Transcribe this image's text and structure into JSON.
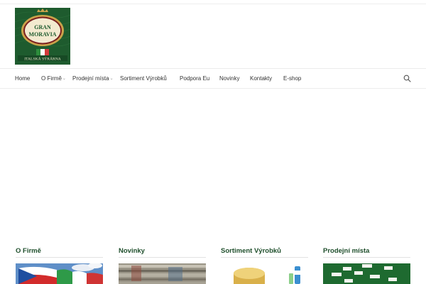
{
  "logo": {
    "brand_line1": "GRAN",
    "brand_line2": "MORAVIA",
    "tagline": "ITALSKÁ SÝRÁRNA",
    "icon": "gran-moravia-logo-icon"
  },
  "nav": {
    "items": [
      {
        "label": "Home"
      },
      {
        "label": "O Firmě",
        "has_submenu": true
      },
      {
        "label": "Prodejní místa",
        "has_submenu": true
      },
      {
        "label": "Sortiment Výrobků"
      },
      {
        "label": "Podpora Eu"
      },
      {
        "label": "Novinky"
      },
      {
        "label": "Kontakty"
      },
      {
        "label": "E-shop"
      }
    ],
    "submenu_icon": "chevron-down-icon",
    "search_icon": "search-icon"
  },
  "columns": [
    {
      "title": "O Firmě",
      "image": "flags-image"
    },
    {
      "title": "Novinky",
      "image": "news-image"
    },
    {
      "title": "Sortiment Výrobků",
      "image": "cheese-products-image"
    },
    {
      "title": "Prodejní místa",
      "image": "sales-map-image"
    }
  ],
  "colors": {
    "brand_green": "#1e5b2e",
    "heading_green": "#1f4f2c",
    "logo_gold": "#c9a24a"
  }
}
